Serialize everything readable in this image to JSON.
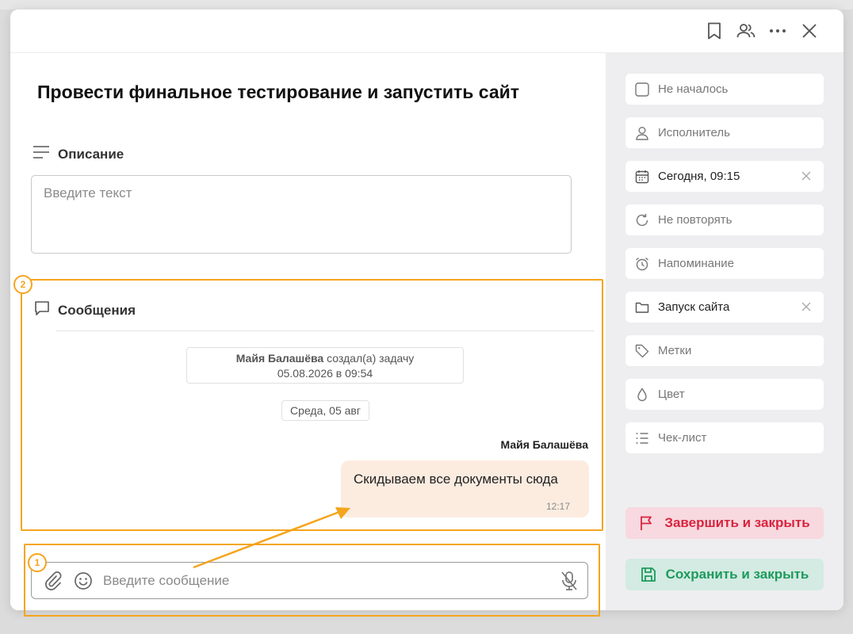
{
  "task": {
    "title": "Провести финальное тестирование и запустить сайт"
  },
  "description": {
    "heading": "Описание",
    "placeholder": "Введите текст"
  },
  "messages": {
    "heading": "Сообщения",
    "event": {
      "author": "Майя Балашёва",
      "action": "создал(а) задачу",
      "datetime": "05.08.2026 в 09:54"
    },
    "date_chip": "Среда, 05 авг",
    "sender": "Майя Балашёва",
    "message": {
      "text": "Скидываем все документы сюда",
      "time": "12:17"
    }
  },
  "composer": {
    "placeholder": "Введите сообщение"
  },
  "sidebar": {
    "fields": [
      {
        "label": "Не началось",
        "icon": "checkbox-icon"
      },
      {
        "label": "Исполнитель",
        "icon": "person-icon"
      },
      {
        "label": "Сегодня, 09:15",
        "icon": "calendar-icon",
        "clearable": true
      },
      {
        "label": "Не повторять",
        "icon": "repeat-icon"
      },
      {
        "label": "Напоминание",
        "icon": "alarm-icon"
      },
      {
        "label": "Запуск сайта",
        "icon": "folder-icon",
        "clearable": true
      },
      {
        "label": "Метки",
        "icon": "tag-icon"
      },
      {
        "label": "Цвет",
        "icon": "drop-icon"
      },
      {
        "label": "Чек-лист",
        "icon": "checklist-icon"
      }
    ],
    "finish_label": "Завершить и закрыть",
    "save_label": "Сохранить и закрыть"
  },
  "annotations": {
    "badge_1": "1",
    "badge_2": "2"
  },
  "colors": {
    "accent_orange": "#f5a41d",
    "finish_red": "#d9243f",
    "save_green": "#1d9a5c",
    "bubble": "#fcece0"
  }
}
